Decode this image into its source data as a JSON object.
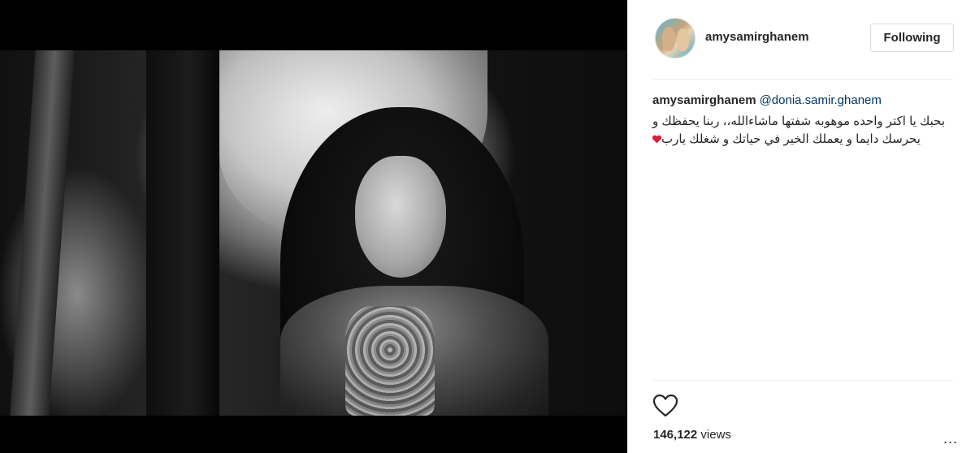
{
  "post": {
    "author": "amysamirghanem",
    "follow_label": "Following",
    "caption": {
      "username": "amysamirghanem",
      "mention": "@donia.samir.ghanem",
      "text": "بحبك يا اكتر واحده موهوبه شفتها ماشاءالله،، ربنا يحفظك و يحرسك دايما و يعملك الخير في حياتك و شغلك يارب"
    },
    "views_count": "146,122",
    "views_label": "views",
    "more_label": "..."
  },
  "icons": {
    "like": "heart-outline-icon",
    "emoji": "red-heart-icon",
    "more": "more-options-icon"
  },
  "colors": {
    "mention": "#003569",
    "text": "#262626",
    "border": "#dbdbdb",
    "emoji_heart": "#d9223a"
  }
}
